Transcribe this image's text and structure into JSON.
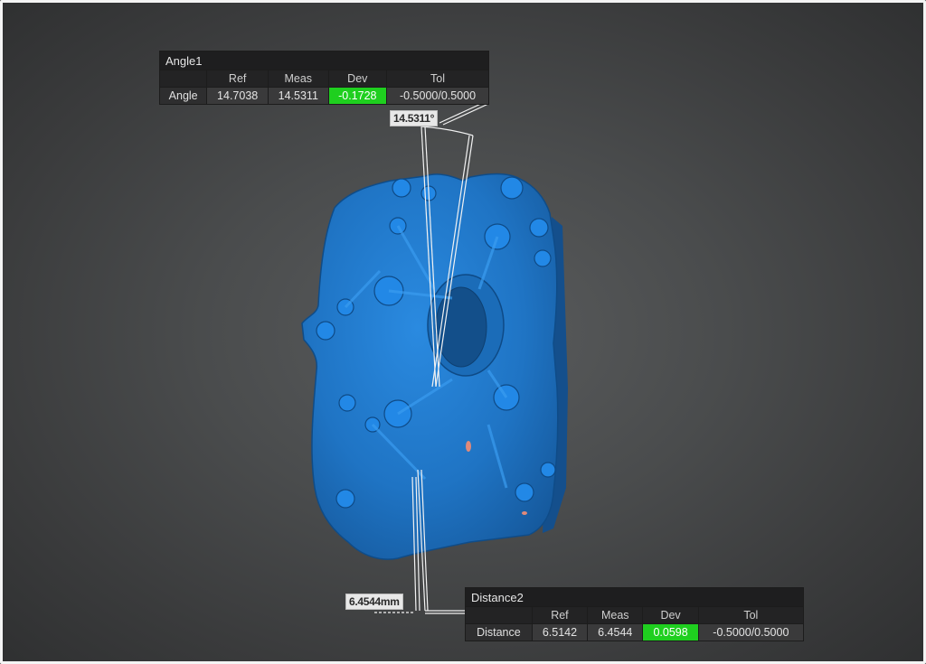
{
  "angle_table": {
    "title": "Angle1",
    "headers": [
      "Ref",
      "Meas",
      "Dev",
      "Tol"
    ],
    "row_label": "Angle",
    "ref": "14.7038",
    "meas": "14.5311",
    "dev": "-0.1728",
    "tol": "-0.5000/0.5000",
    "dev_color": "#1fcf1f"
  },
  "angle_callout": "14.5311°",
  "distance_table": {
    "title": "Distance2",
    "headers": [
      "Ref",
      "Meas",
      "Dev",
      "Tol"
    ],
    "row_label": "Distance",
    "ref": "6.5142",
    "meas": "6.4544",
    "dev": "0.0598",
    "tol": "-0.5000/0.5000",
    "dev_color": "#1fcf1f"
  },
  "distance_callout": "6.4544mm",
  "part": {
    "color": "#1f78c8",
    "icon": "gearbox-cover-3d-model"
  }
}
